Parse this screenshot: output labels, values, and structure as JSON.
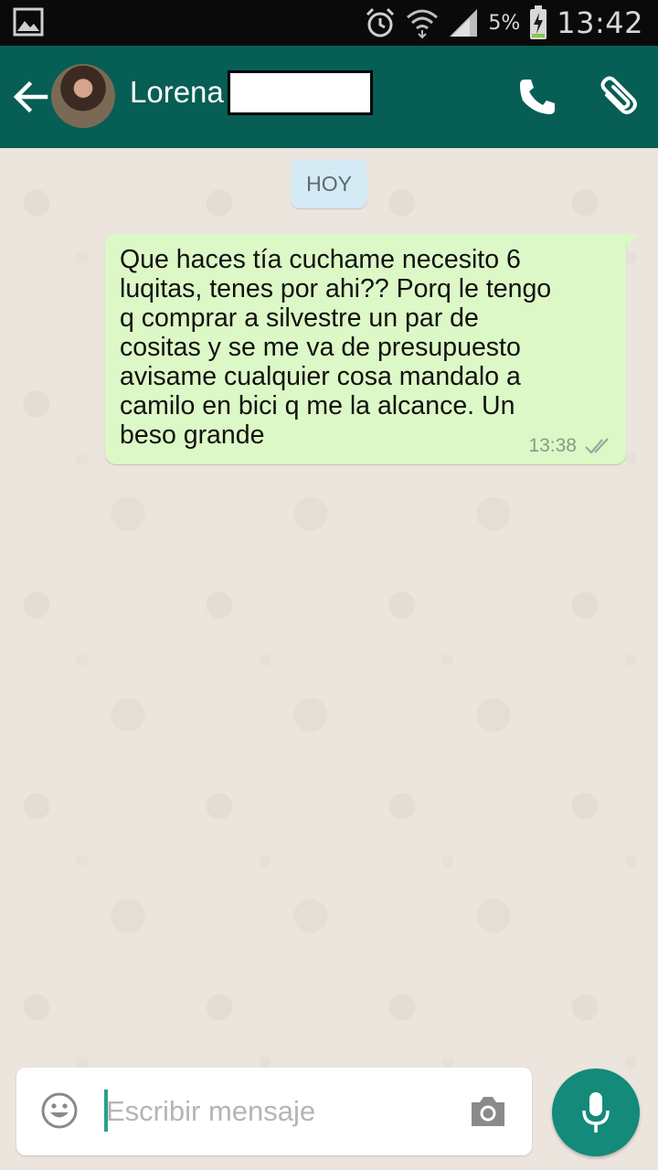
{
  "status_bar": {
    "battery_percent": "5%",
    "time": "13:42",
    "icons": [
      "gallery-icon",
      "alarm-icon",
      "wifi-icon",
      "signal-icon",
      "battery-charging-icon"
    ]
  },
  "header": {
    "contact_name": "Lorena",
    "icons": [
      "back-arrow-icon",
      "phone-icon",
      "paperclip-icon"
    ]
  },
  "chat": {
    "date_label": "HOY",
    "messages": [
      {
        "direction": "outgoing",
        "text": "Que haces tía cuchame necesito 6\nluqitas, tenes por ahi?? Porq le tengo\nq comprar a silvestre un par de\ncositas y se me va de presupuesto\navisame cualquier cosa mandalo a\ncamilo en bici q me la alcance. Un\nbeso grande",
        "time": "13:38",
        "status_icon": "double-check-icon"
      }
    ]
  },
  "composer": {
    "placeholder": "Escribir mensaje",
    "icons": [
      "emoji-icon",
      "camera-icon",
      "mic-icon"
    ]
  },
  "colors": {
    "toolbar": "#075e54",
    "bubble_outgoing": "#dcf8c6",
    "date_chip": "#d4eaf4",
    "mic_button": "#138a7a",
    "chat_background": "#ece5dd"
  }
}
